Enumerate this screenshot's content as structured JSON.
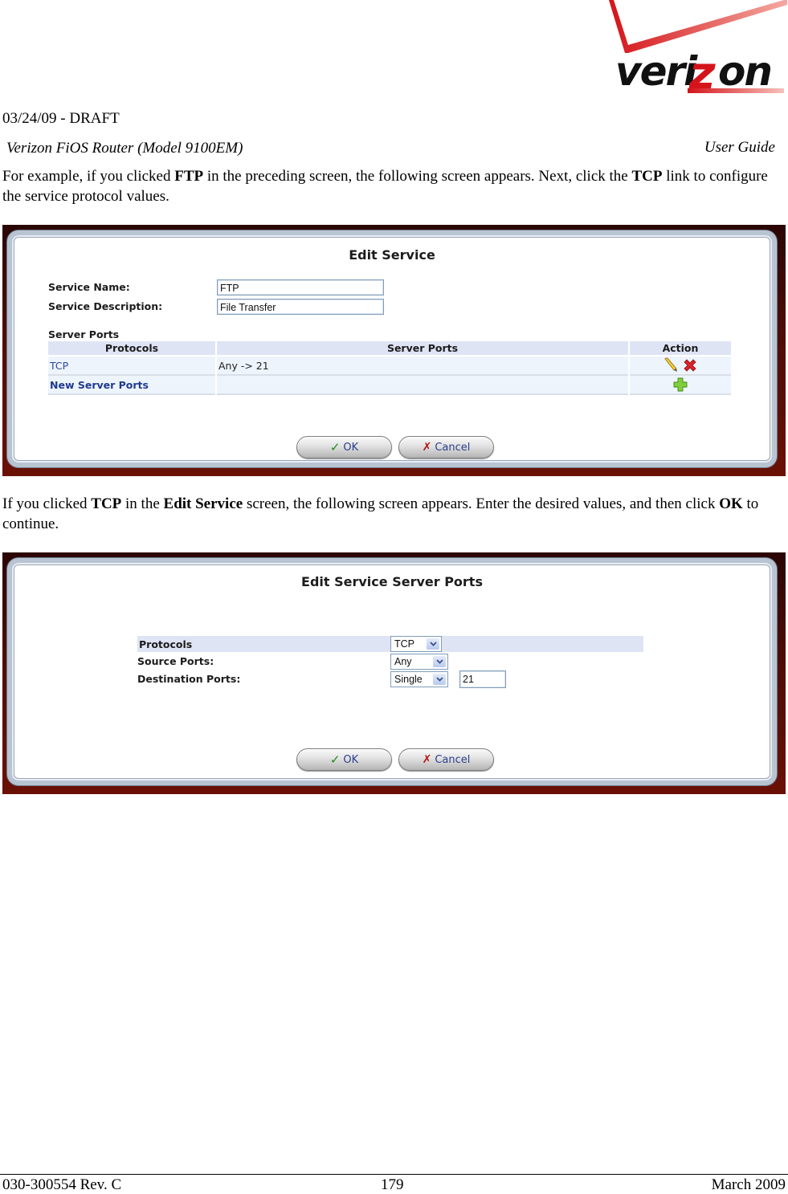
{
  "header": {
    "logo_text": "verizon",
    "draft_line": "03/24/09 - DRAFT",
    "doc_title": "Verizon FiOS Router (Model 9100EM)",
    "doc_type": "User Guide"
  },
  "paragraph1": {
    "t1": "For example, if you clicked ",
    "b1": "FTP",
    "t2": " in the preceding screen, the following screen appears. Next, click the ",
    "b2": "TCP",
    "t3": " link to configure the service protocol values."
  },
  "edit_service": {
    "title": "Edit Service",
    "service_name_label": "Service Name:",
    "service_name_value": "FTP",
    "service_description_label": "Service Description:",
    "service_description_value": "File Transfer",
    "server_ports_heading": "Server Ports",
    "columns": [
      "Protocols",
      "Server Ports",
      "Action"
    ],
    "rows": [
      {
        "protocol": "TCP",
        "ports": "Any -> 21",
        "actions": [
          "edit-icon",
          "delete-icon"
        ]
      },
      {
        "protocol": "New Server Ports",
        "ports": "",
        "actions": [
          "add-icon"
        ]
      }
    ],
    "ok_label": "OK",
    "cancel_label": "Cancel"
  },
  "paragraph2": {
    "t1": "If you clicked ",
    "b1": "TCP",
    "t2": " in the ",
    "b2": "Edit Service",
    "t3": " screen, the following screen appears. Enter the desired values, and then click ",
    "b3": "OK",
    "t4": " to continue."
  },
  "edit_server_ports": {
    "title": "Edit Service Server Ports",
    "protocols_label": "Protocols",
    "protocols_value": "TCP",
    "source_ports_label": "Source Ports:",
    "source_ports_value": "Any",
    "destination_ports_label": "Destination Ports:",
    "destination_ports_value": "Single",
    "destination_port_number": "21",
    "ok_label": "OK",
    "cancel_label": "Cancel"
  },
  "footer": {
    "doc_number": "030-300554 Rev. C",
    "page_number": "179",
    "date": "March 2009"
  },
  "colors": {
    "brand_red": "#e3151a",
    "frame_dark": "#6a1005",
    "table_header": "#dfe4f5",
    "link_blue": "#2a48a0"
  }
}
